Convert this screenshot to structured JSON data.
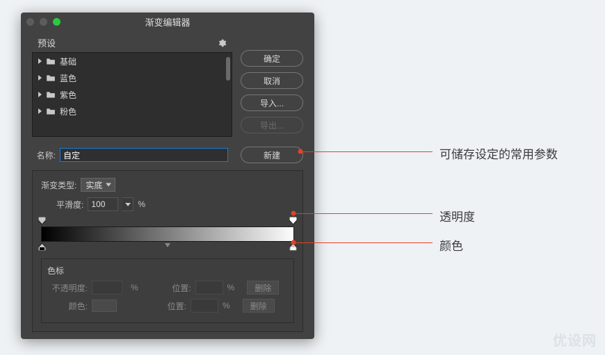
{
  "window": {
    "title": "渐变编辑器"
  },
  "presets": {
    "header": "预设",
    "items": [
      {
        "label": "基础"
      },
      {
        "label": "蓝色"
      },
      {
        "label": "紫色"
      },
      {
        "label": "粉色"
      }
    ]
  },
  "buttons": {
    "ok": "确定",
    "cancel": "取消",
    "import": "导入...",
    "export": "导出...",
    "new": "新建"
  },
  "name": {
    "label": "名称:",
    "value": "自定"
  },
  "gradient": {
    "type_label": "渐变类型:",
    "type_value": "实底",
    "smooth_label": "平滑度:",
    "smooth_value": "100",
    "pct": "%"
  },
  "stops_panel": {
    "title": "色标",
    "opacity_label": "不透明度:",
    "color_label": "颜色:",
    "position_label": "位置:",
    "delete_label": "删除",
    "pct": "%"
  },
  "annotations": {
    "new_note": "可储存设定的常用参数",
    "opacity_note": "透明度",
    "color_note": "颜色"
  },
  "watermark": "优设网",
  "chart_data": {
    "type": "table",
    "description": "Photoshop Gradient Editor state",
    "gradient": {
      "type": "solid",
      "smoothness_pct": 100,
      "opacity_stops": [
        {
          "position_pct": 0,
          "opacity_pct": 100
        },
        {
          "position_pct": 100,
          "opacity_pct": 100
        }
      ],
      "color_stops": [
        {
          "position_pct": 0,
          "color": "#000000"
        },
        {
          "position_pct": 100,
          "color": "#ffffff"
        }
      ]
    }
  }
}
